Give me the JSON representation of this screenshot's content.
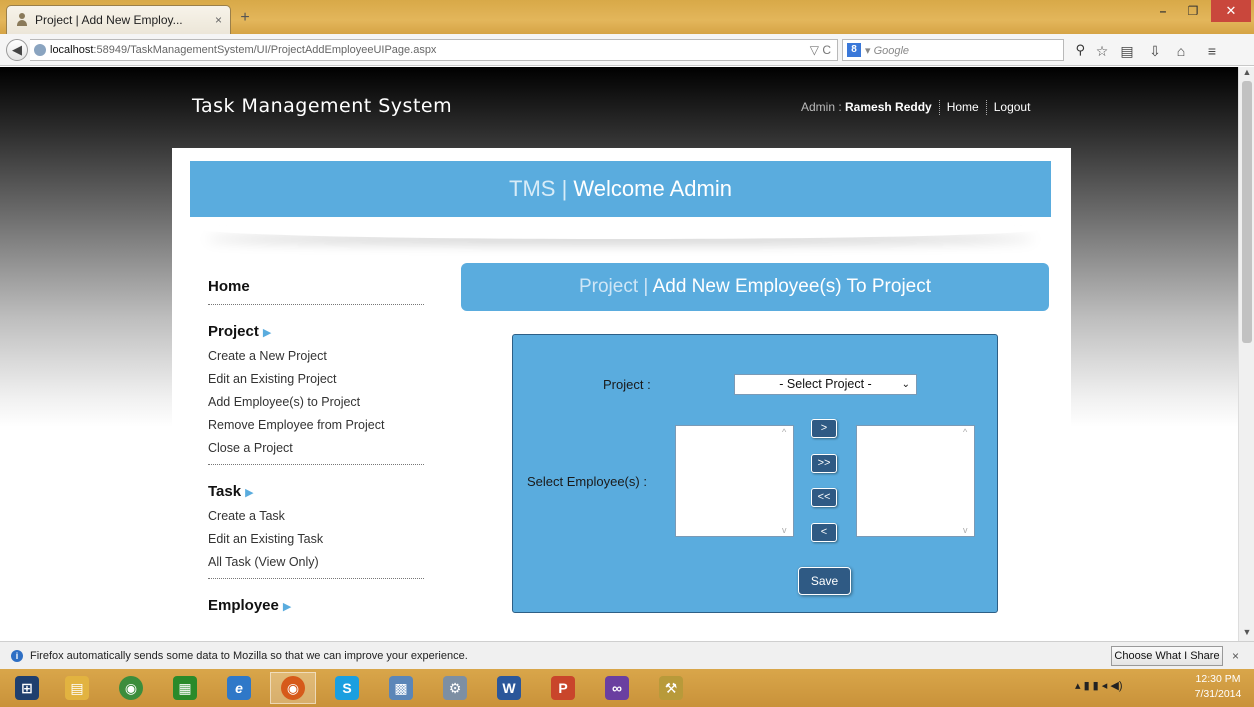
{
  "browser": {
    "tab_title": "Project | Add New Employ...",
    "tab_close": "×",
    "new_tab": "+",
    "url_host": "localhost",
    "url_rest": ":58949/TaskManagementSystem/UI/ProjectAddEmployeeUIPage.aspx",
    "url_controls": "▽ C",
    "search_engine_letter": "8",
    "search_placeholder": "▾ Google",
    "window_min": "–",
    "window_max": "❐",
    "window_close": "✕"
  },
  "site": {
    "title": "Task Management System",
    "user_prefix": "Admin : ",
    "user_name": "Ramesh Reddy",
    "nav_home": "Home",
    "nav_logout": "Logout"
  },
  "banner": {
    "prefix": "TMS | ",
    "main": "Welcome Admin"
  },
  "sidebar": {
    "home": "Home",
    "project": {
      "heading": "Project",
      "links": [
        "Create a New Project",
        "Edit an Existing Project",
        "Add Employee(s) to Project",
        "Remove Employee from Project",
        "Close a Project"
      ]
    },
    "task": {
      "heading": "Task",
      "links": [
        "Create a Task",
        "Edit an Existing Task",
        "All Task (View Only)"
      ]
    },
    "employee": {
      "heading": "Employee"
    }
  },
  "page_header": {
    "prefix": "Project | ",
    "main": "Add New Employee(s) To Project"
  },
  "form": {
    "project_label": "Project :",
    "project_select_value": "- Select Project -",
    "employees_label": "Select Employee(s) :",
    "btn_add_one": ">",
    "btn_add_all": ">>",
    "btn_remove_all": "<<",
    "btn_remove_one": "<",
    "save_label": "Save"
  },
  "notification": {
    "message": "Firefox automatically sends some data to Mozilla so that we can improve your experience.",
    "share_button": "Choose What I Share",
    "close": "×"
  },
  "taskbar": {
    "tray_icons": "▴  ▮  ▮  ◂  ◀)",
    "time": "12:30 PM",
    "date": "7/31/2014"
  },
  "colors": {
    "accent_blue": "#5aacde",
    "button_dark_blue": "#2f5a84",
    "chrome_gold": "#d8a948"
  }
}
